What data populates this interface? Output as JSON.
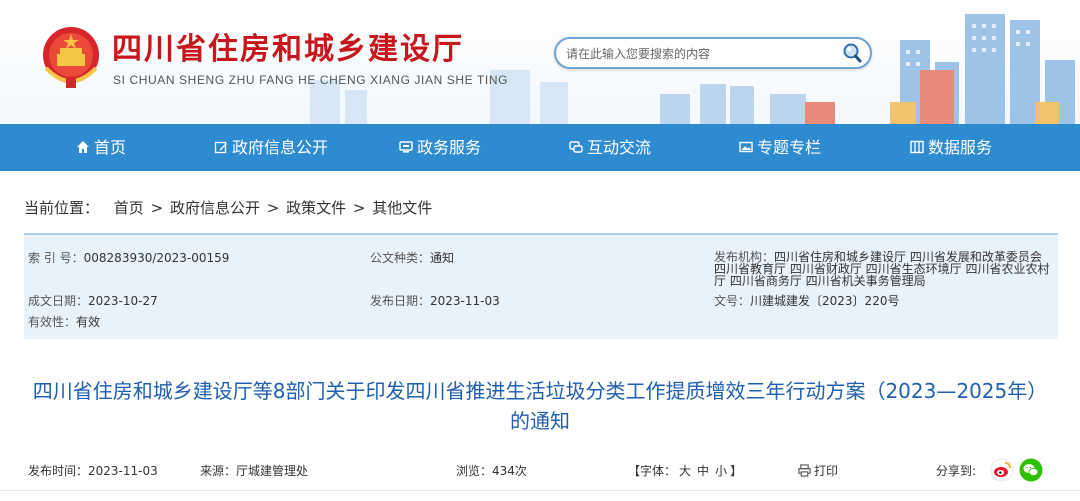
{
  "site": {
    "title": "四川省住房和城乡建设厅",
    "pinyin": "SI CHUAN SHENG ZHU FANG HE CHENG XIANG JIAN SHE TING"
  },
  "search": {
    "placeholder": "请在此输入您要搜索的内容"
  },
  "nav": {
    "items": [
      {
        "label": "首页",
        "icon": "home-icon"
      },
      {
        "label": "政府信息公开",
        "icon": "edit-icon"
      },
      {
        "label": "政务服务",
        "icon": "monitor-icon"
      },
      {
        "label": "互动交流",
        "icon": "chat-icon"
      },
      {
        "label": "专题专栏",
        "icon": "image-icon"
      },
      {
        "label": "数据服务",
        "icon": "grid-icon"
      }
    ]
  },
  "breadcrumb": {
    "label": "当前位置：",
    "items": [
      "首页",
      "政府信息公开",
      "政策文件",
      "其他文件"
    ],
    "separator": ">"
  },
  "meta": {
    "index_key": "索 引 号：",
    "index_val": "008283930/2023-00159",
    "type_key": "公文种类：",
    "type_val": "通知",
    "org_key": "发布机构：",
    "org_val": "四川省住房和城乡建设厅 四川省发展和改革委员会 四川省教育厅 四川省财政厅 四川省生态环境厅 四川省农业农村厅 四川省商务厅 四川省机关事务管理局",
    "created_key": "成文日期：",
    "created_val": "2023-10-27",
    "published_key": "发布日期：",
    "published_val": "2023-11-03",
    "docno_key": "文号：",
    "docno_val": "川建城建发〔2023〕220号",
    "validity_key": "有效性：",
    "validity_val": "有效"
  },
  "article": {
    "title": "四川省住房和城乡建设厅等8部门关于印发四川省推进生活垃圾分类工作提质增效三年行动方案（2023—2025年）的通知"
  },
  "info": {
    "pubtime": "发布时间：2023-11-03",
    "source": "来源：厅城建管理处",
    "views": "浏览：434次",
    "font_open": "【字体：",
    "font_big": "大",
    "font_mid": "中",
    "font_small": "小",
    "font_close": "】",
    "print": "打印",
    "share": "分享到:"
  },
  "colors": {
    "brand_red": "#c8161d",
    "nav_blue": "#2f8bd0",
    "title_blue": "#1f5fb0",
    "meta_bg": "#e7f2fb"
  }
}
